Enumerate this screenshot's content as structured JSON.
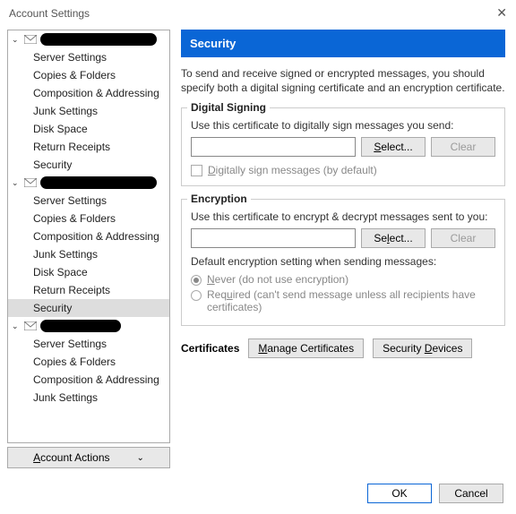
{
  "window": {
    "title": "Account Settings"
  },
  "sidebar": {
    "accounts": [
      {
        "items": [
          "Server Settings",
          "Copies & Folders",
          "Composition & Addressing",
          "Junk Settings",
          "Disk Space",
          "Return Receipts",
          "Security"
        ],
        "selected": null
      },
      {
        "items": [
          "Server Settings",
          "Copies & Folders",
          "Composition & Addressing",
          "Junk Settings",
          "Disk Space",
          "Return Receipts",
          "Security"
        ],
        "selected": 6
      },
      {
        "items": [
          "Server Settings",
          "Copies & Folders",
          "Composition & Addressing",
          "Junk Settings"
        ],
        "selected": null
      }
    ],
    "actions_label": "Account Actions"
  },
  "panel": {
    "title": "Security",
    "intro": "To send and receive signed or encrypted messages, you should specify both a digital signing certificate and an encryption certificate.",
    "signing": {
      "title": "Digital Signing",
      "hint": "Use this certificate to digitally sign messages you send:",
      "value": "",
      "select_label": "Select...",
      "clear_label": "Clear",
      "checkbox_label": "Digitally sign messages (by default)"
    },
    "encryption": {
      "title": "Encryption",
      "hint": "Use this certificate to encrypt & decrypt messages sent to you:",
      "value": "",
      "select_label": "Select...",
      "clear_label": "Clear",
      "default_label": "Default encryption setting when sending messages:",
      "opt_never": "Never (do not use encryption)",
      "opt_required": "Required (can't send message unless all recipients have certificates)"
    },
    "certs": {
      "title": "Certificates",
      "manage": "Manage Certificates",
      "devices": "Security Devices"
    }
  },
  "footer": {
    "ok": "OK",
    "cancel": "Cancel"
  }
}
